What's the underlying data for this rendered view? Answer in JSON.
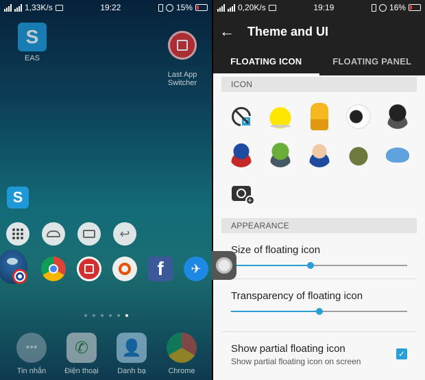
{
  "left": {
    "statusbar": {
      "net_speed": "1,33K/s",
      "time": "19:22",
      "battery": "15%"
    },
    "apps_top": [
      {
        "label": "EAS"
      },
      {
        "label": "Last App\nSwitcher"
      }
    ],
    "dock_labels": [
      "Tin nhắn",
      "Điện thoại",
      "Danh bạ",
      "Chrome"
    ]
  },
  "right": {
    "statusbar": {
      "net_speed": "0,20K/s",
      "time": "19:19",
      "battery": "16%"
    },
    "title": "Theme and UI",
    "tabs": [
      "FLOATING ICON",
      "FLOATING PANEL"
    ],
    "active_tab": "FLOATING ICON",
    "section_icon": "ICON",
    "icons": [
      "no-icon",
      "chick",
      "giraffe",
      "sheep",
      "batman",
      "captain-america",
      "hulk",
      "superman",
      "turtle",
      "whale",
      "add-photo"
    ],
    "section_appearance": "APPEARANCE",
    "size_label": "Size of floating icon",
    "size_value": 0.45,
    "transparency_label": "Transparency of floating icon",
    "transparency_value": 0.5,
    "partial_label": "Show partial floating icon",
    "partial_sub": "Show partial floating icon on screen",
    "partial_checked": true
  },
  "colors": {
    "accent": "#2a9fd6",
    "toolbar": "#212121"
  }
}
